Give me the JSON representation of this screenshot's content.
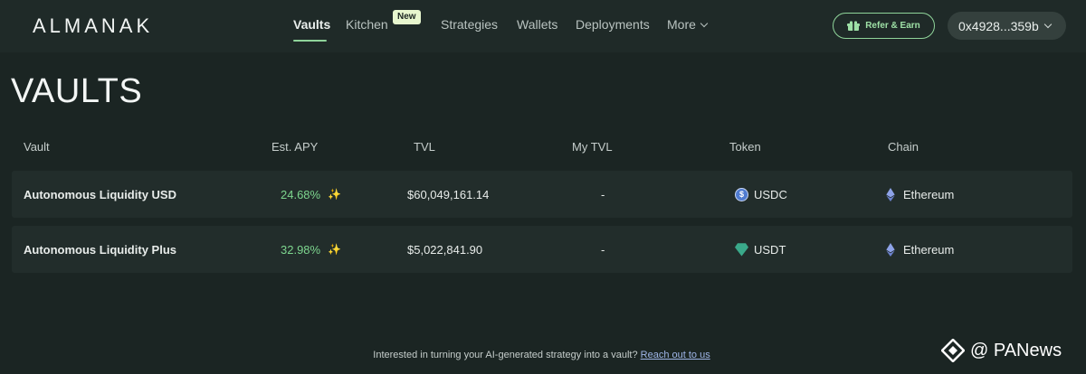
{
  "header": {
    "logo": "ALMANAK",
    "nav": [
      {
        "label": "Vaults",
        "active": true
      },
      {
        "label": "Kitchen",
        "badge": "New"
      },
      {
        "label": "Strategies"
      },
      {
        "label": "Wallets"
      },
      {
        "label": "Deployments"
      },
      {
        "label": "More"
      }
    ],
    "refer_label": "Refer & Earn",
    "wallet_address": "0x4928...359b"
  },
  "page": {
    "title": "VAULTS"
  },
  "table": {
    "headers": [
      "Vault",
      "Est. APY",
      "TVL",
      "My TVL",
      "Token",
      "Chain"
    ],
    "rows": [
      {
        "vault": "Autonomous Liquidity USD",
        "apy": "24.68%",
        "tvl": "$60,049,161.14",
        "my_tvl": "-",
        "token": "USDC",
        "token_icon": "usdc-icon",
        "chain": "Ethereum",
        "chain_icon": "ethereum-icon"
      },
      {
        "vault": "Autonomous Liquidity Plus",
        "apy": "32.98%",
        "tvl": "$5,022,841.90",
        "my_tvl": "-",
        "token": "USDT",
        "token_icon": "usdt-icon",
        "chain": "Ethereum",
        "chain_icon": "ethereum-icon"
      }
    ]
  },
  "footer": {
    "text": "Interested in turning your AI-generated strategy into a vault?",
    "link": "Reach out to us"
  },
  "watermark": {
    "text": "@ PANews"
  },
  "colors": {
    "background": "#1b2523",
    "accent": "#8fd49a",
    "apy": "#7dd58e",
    "badge": "#e7f6ce"
  }
}
